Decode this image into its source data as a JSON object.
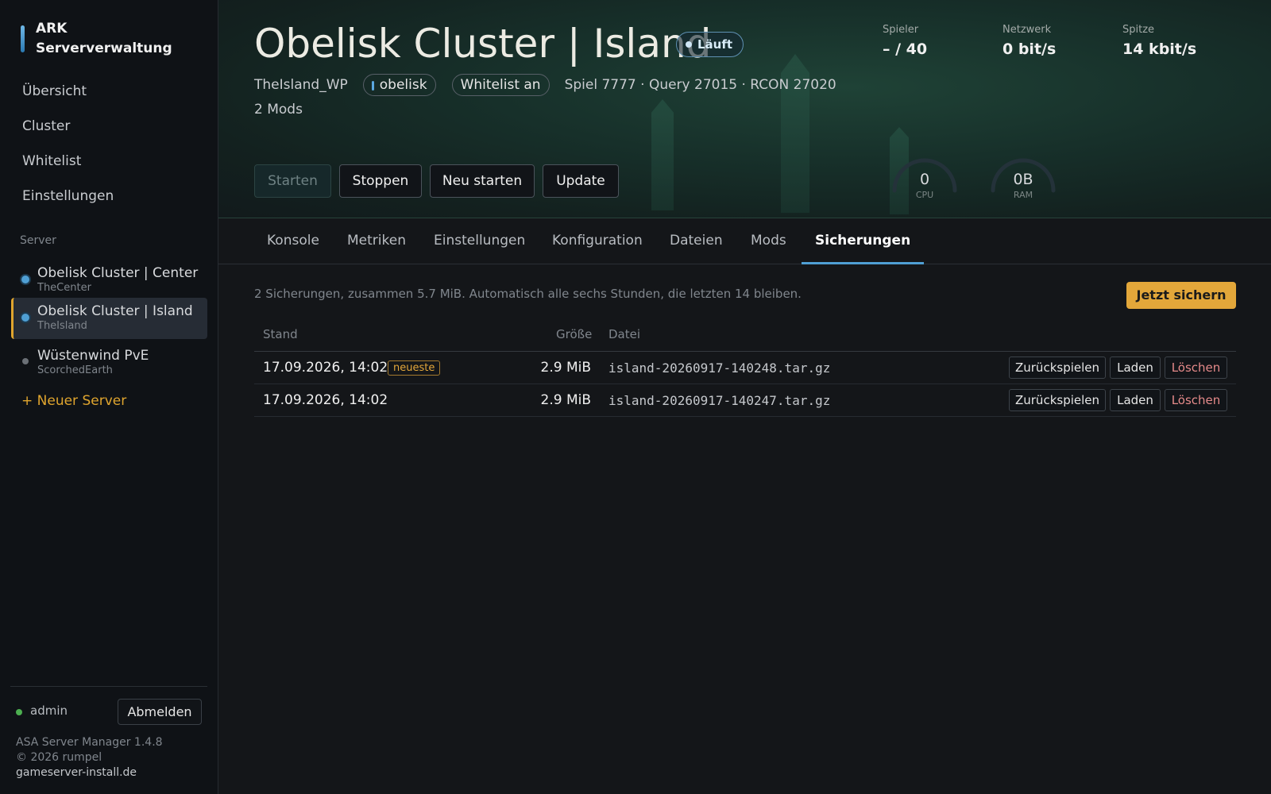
{
  "sidebar": {
    "brand": "ARK Serververwaltung",
    "nav": [
      "Übersicht",
      "Cluster",
      "Whitelist",
      "Einstellungen"
    ],
    "section_label": "Server",
    "servers": [
      {
        "name": "Obelisk Cluster | Center",
        "map": "TheCenter",
        "status_color": "#4f9fd4"
      },
      {
        "name": "Obelisk Cluster | Island",
        "map": "TheIsland",
        "status_color": "#4f9fd4"
      },
      {
        "name": "Wüstenwind PvE",
        "map": "ScorchedEarth",
        "status_color": "#6b7076"
      }
    ],
    "new_server": "+ Neuer Server",
    "user": "admin",
    "logout": "Abmelden",
    "footer": {
      "version": "ASA Server Manager 1.4.8",
      "copyright": "© 2026 rumpel",
      "link": "gameserver-install.de"
    }
  },
  "hero": {
    "title": "Obelisk Cluster | Island",
    "status": "Läuft",
    "map_id": "TheIsland_WP",
    "cluster_tag": "obelisk",
    "whitelist_tag": "Whitelist an",
    "ports": "Spiel 7777 · Query 27015 · RCON 27020",
    "mods": "2 Mods",
    "stats": {
      "players_label": "Spieler",
      "players_value": "– / 40",
      "network_label": "Netzwerk",
      "network_value": "0 bit/s",
      "peak_label": "Spitze",
      "peak_value": "14 kbit/s"
    },
    "actions": {
      "start": "Starten",
      "stop": "Stoppen",
      "restart": "Neu starten",
      "update": "Update"
    },
    "gauges": {
      "cpu_value": "0",
      "cpu_label": "CPU",
      "cpu_fraction": 0,
      "ram_value": "0B",
      "ram_label": "RAM",
      "ram_fraction": 0
    }
  },
  "tabs": [
    "Konsole",
    "Metriken",
    "Einstellungen",
    "Konfiguration",
    "Dateien",
    "Mods",
    "Sicherungen"
  ],
  "active_tab": "Sicherungen",
  "backups": {
    "info": "2 Sicherungen, zusammen 5.7 MiB. Automatisch alle sechs Stunden, die letzten 14 bleiben.",
    "backup_now": "Jetzt sichern",
    "columns": {
      "stand": "Stand",
      "size": "Größe",
      "file": "Datei"
    },
    "rows": [
      {
        "date": "17.09.2026, 14:02",
        "badge": "neueste",
        "size": "2.9 MiB",
        "file": "island-20260917-140248.tar.gz"
      },
      {
        "date": "17.09.2026, 14:02",
        "badge": "",
        "size": "2.9 MiB",
        "file": "island-20260917-140247.tar.gz"
      }
    ],
    "row_actions": {
      "restore": "Zurückspielen",
      "load": "Laden",
      "delete": "Löschen"
    }
  },
  "colors": {
    "accent": "#e3a73a",
    "tab_active": "#4f9fd4",
    "danger": "#e58a8a",
    "online": "#4caf50"
  }
}
